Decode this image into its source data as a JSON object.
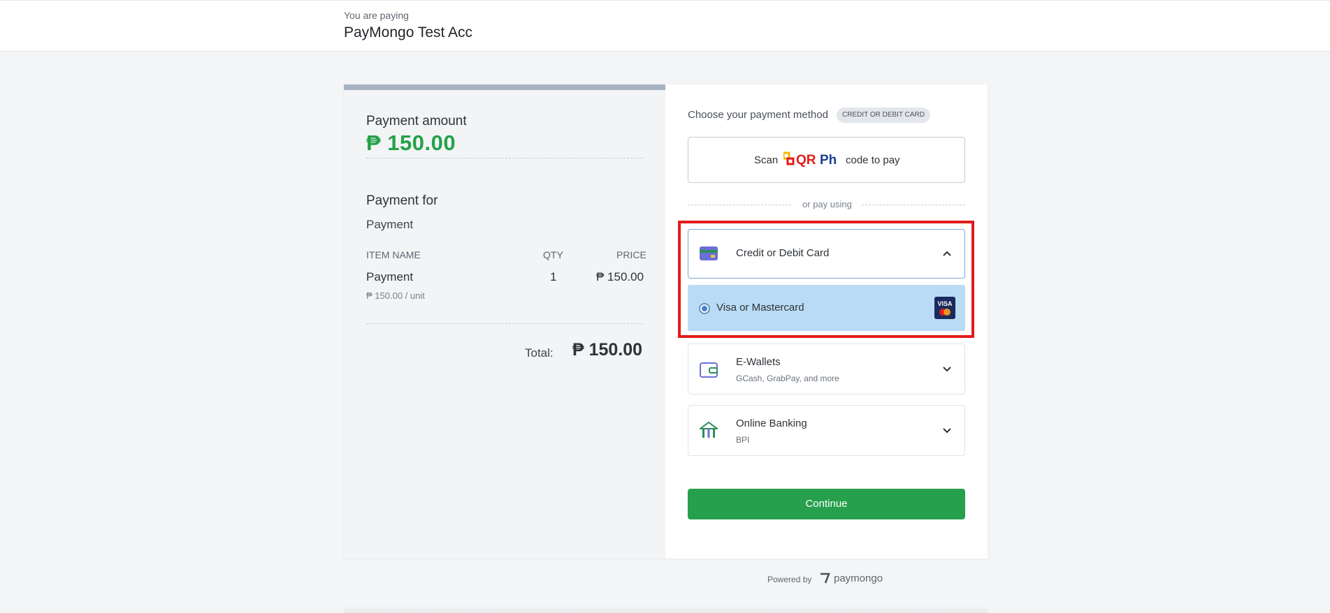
{
  "header": {
    "paying_label": "You are paying",
    "merchant": "PayMongo Test Acc"
  },
  "summary": {
    "payment_amount_label": "Payment amount",
    "payment_amount": "₱ 150.00",
    "payment_for_label": "Payment for",
    "payment_for_value": "Payment",
    "columns": {
      "item": "ITEM NAME",
      "qty": "QTY",
      "price": "PRICE"
    },
    "items": [
      {
        "name": "Payment",
        "qty": "1",
        "price": "₱ 150.00",
        "unit": "₱ 150.00 / unit"
      }
    ],
    "total_label": "Total:",
    "total_value": "₱ 150.00"
  },
  "methods": {
    "choose_label": "Choose your payment method",
    "badge": "CREDIT OR DEBIT CARD",
    "qr": {
      "scan": "Scan",
      "logo_text_qr": "QR",
      "logo_text_ph": "Ph",
      "code": "code to pay"
    },
    "or_pay_using": "or pay using",
    "card": {
      "name": "Credit or Debit Card",
      "option": "Visa or Mastercard",
      "visa": "VISA"
    },
    "ewallets": {
      "name": "E-Wallets",
      "sub": "GCash, GrabPay, and more"
    },
    "banking": {
      "name": "Online Banking",
      "sub": "BPI"
    },
    "continue_label": "Continue"
  },
  "footer": {
    "powered_by": "Powered by",
    "brand": "paymongo"
  },
  "colors": {
    "accent_green": "#27a04d",
    "amount_green": "#24a148",
    "highlight_red": "#e31b1b",
    "selected_blue": "#b9dbf5"
  }
}
